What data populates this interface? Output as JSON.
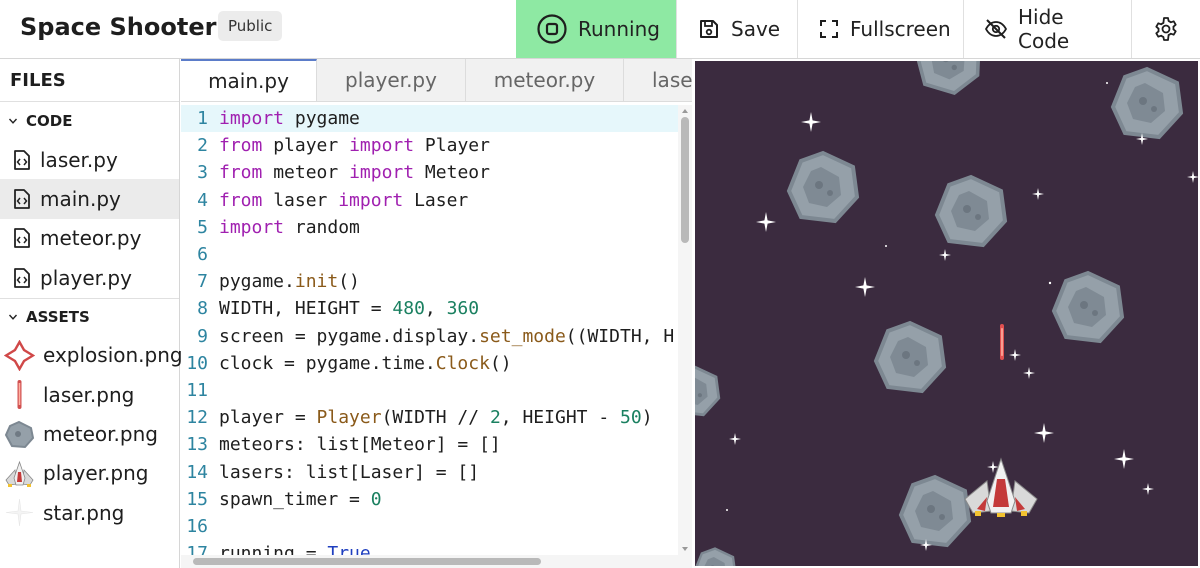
{
  "header": {
    "title": "Space Shooter",
    "visibility_badge": "Public",
    "run_label": "Running",
    "save_label": "Save",
    "fullscreen_label": "Fullscreen",
    "hide_code_label": "Hide Code",
    "accent_running": "#8ee9a3"
  },
  "sidebar": {
    "heading": "FILES",
    "code_section": "CODE",
    "assets_section": "ASSETS",
    "code_files": [
      {
        "name": "laser.py",
        "active": false
      },
      {
        "name": "main.py",
        "active": true
      },
      {
        "name": "meteor.py",
        "active": false
      },
      {
        "name": "player.py",
        "active": false
      }
    ],
    "assets": [
      {
        "name": "explosion.png",
        "icon": "explosion-icon"
      },
      {
        "name": "laser.png",
        "icon": "laser-icon"
      },
      {
        "name": "meteor.png",
        "icon": "meteor-icon"
      },
      {
        "name": "player.png",
        "icon": "player-ship-icon"
      },
      {
        "name": "star.png",
        "icon": "star-icon"
      }
    ]
  },
  "editor": {
    "tabs": [
      "main.py",
      "player.py",
      "meteor.py",
      "laser.py"
    ],
    "active_tab": "main.py",
    "lines": [
      {
        "n": "1",
        "tokens": [
          [
            "k",
            "import"
          ],
          [
            "t",
            " pygame"
          ]
        ]
      },
      {
        "n": "2",
        "tokens": [
          [
            "k",
            "from"
          ],
          [
            "t",
            " player "
          ],
          [
            "k",
            "import"
          ],
          [
            "t",
            " Player"
          ]
        ]
      },
      {
        "n": "3",
        "tokens": [
          [
            "k",
            "from"
          ],
          [
            "t",
            " meteor "
          ],
          [
            "k",
            "import"
          ],
          [
            "t",
            " Meteor"
          ]
        ]
      },
      {
        "n": "4",
        "tokens": [
          [
            "k",
            "from"
          ],
          [
            "t",
            " laser "
          ],
          [
            "k",
            "import"
          ],
          [
            "t",
            " Laser"
          ]
        ]
      },
      {
        "n": "5",
        "tokens": [
          [
            "k",
            "import"
          ],
          [
            "t",
            " random"
          ]
        ]
      },
      {
        "n": "6",
        "tokens": []
      },
      {
        "n": "7",
        "tokens": [
          [
            "t",
            "pygame."
          ],
          [
            "f",
            "init"
          ],
          [
            "t",
            "()"
          ]
        ]
      },
      {
        "n": "8",
        "tokens": [
          [
            "t",
            "WIDTH, HEIGHT = "
          ],
          [
            "n",
            "480"
          ],
          [
            "t",
            ", "
          ],
          [
            "n",
            "360"
          ]
        ]
      },
      {
        "n": "9",
        "tokens": [
          [
            "t",
            "screen = pygame.display."
          ],
          [
            "f",
            "set_mode"
          ],
          [
            "t",
            "((WIDTH, H"
          ]
        ]
      },
      {
        "n": "10",
        "tokens": [
          [
            "t",
            "clock = pygame.time."
          ],
          [
            "f",
            "Clock"
          ],
          [
            "t",
            "()"
          ]
        ]
      },
      {
        "n": "11",
        "tokens": []
      },
      {
        "n": "12",
        "tokens": [
          [
            "t",
            "player = "
          ],
          [
            "f",
            "Player"
          ],
          [
            "t",
            "(WIDTH // "
          ],
          [
            "n",
            "2"
          ],
          [
            "t",
            ", HEIGHT - "
          ],
          [
            "n",
            "50"
          ],
          [
            "t",
            ")"
          ]
        ]
      },
      {
        "n": "13",
        "tokens": [
          [
            "t",
            "meteors: list[Meteor] = []"
          ]
        ]
      },
      {
        "n": "14",
        "tokens": [
          [
            "t",
            "lasers: list[Laser] = []"
          ]
        ]
      },
      {
        "n": "15",
        "tokens": [
          [
            "t",
            "spawn_timer = "
          ],
          [
            "n",
            "0"
          ]
        ]
      },
      {
        "n": "16",
        "tokens": []
      },
      {
        "n": "17",
        "tokens": [
          [
            "t",
            "running = "
          ],
          [
            "b",
            "True"
          ]
        ]
      }
    ]
  },
  "game": {
    "background": "#3b2b3f"
  }
}
